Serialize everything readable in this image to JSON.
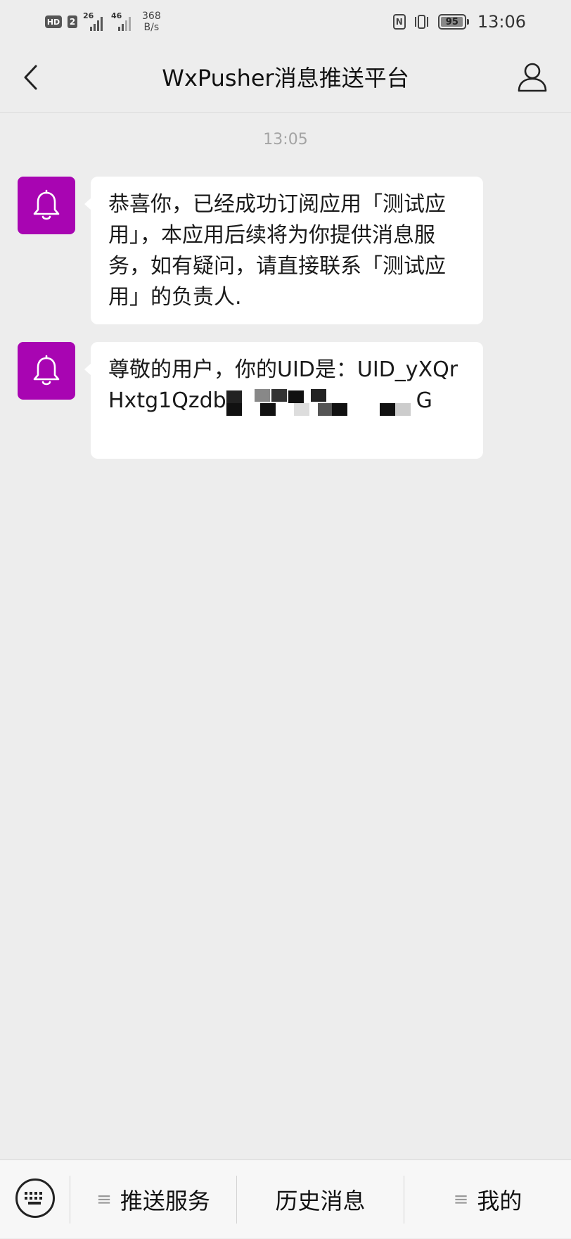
{
  "status_bar": {
    "hd_label": "HD",
    "sim_label": "2",
    "sim1_network": "26",
    "sim2_network": "46",
    "net_speed_value": "368",
    "net_speed_unit": "B/s",
    "nfc_label": "N",
    "battery_level": "95",
    "time": "13:06"
  },
  "nav": {
    "title": "WxPusher消息推送平台",
    "back_icon": "chevron-left-icon",
    "profile_icon": "user-icon"
  },
  "chat": {
    "timestamp": "13:05",
    "messages": [
      {
        "avatar_icon": "bell-icon",
        "text": "恭喜你，已经成功订阅应用「测试应用」，本应用后续将为你提供消息服务，如有疑问，请直接联系「测试应用」的负责人."
      },
      {
        "avatar_icon": "bell-icon",
        "text_prefix": "尊敬的用户，你的UID是：UID_yXQrHxtg1Qzdb",
        "text_suffix": "G"
      }
    ]
  },
  "bottom_menu": {
    "keyboard_icon": "keyboard-icon",
    "items": [
      {
        "label": "推送服务",
        "icon": "menu-lines-icon"
      },
      {
        "label": "历史消息"
      },
      {
        "label": "我的",
        "icon": "menu-lines-icon"
      }
    ]
  },
  "colors": {
    "background": "#ededed",
    "avatar_bg": "#a805b2",
    "bubble_bg": "#ffffff",
    "bottom_bar_bg": "#f7f7f7"
  }
}
